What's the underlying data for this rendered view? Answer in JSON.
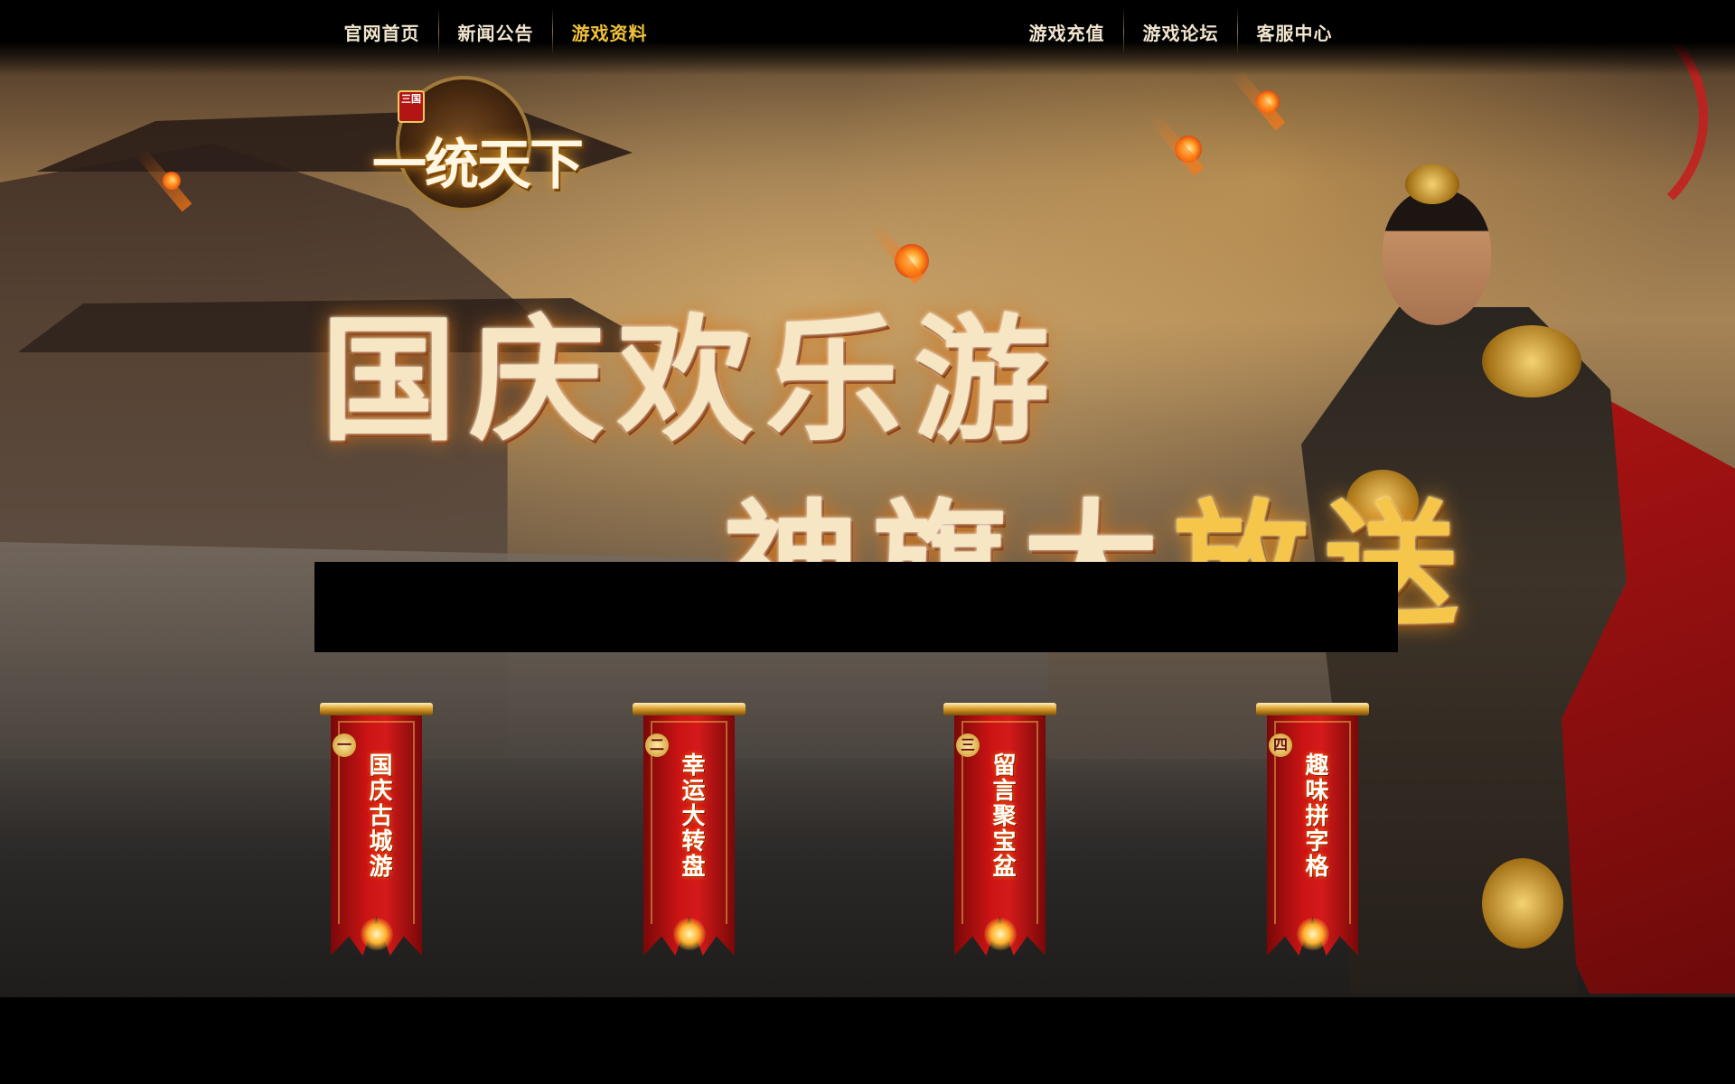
{
  "nav": {
    "left": [
      {
        "label": "官网首页",
        "active": false
      },
      {
        "label": "新闻公告",
        "active": false
      },
      {
        "label": "游戏资料",
        "active": true
      }
    ],
    "right": [
      {
        "label": "游戏充值"
      },
      {
        "label": "游戏论坛"
      },
      {
        "label": "客服中心"
      }
    ],
    "active_color": "#f0c23a"
  },
  "logo": {
    "badge": "三国",
    "title": "一统天下"
  },
  "headline": {
    "line1": "国庆欢乐游",
    "line2_white": "神旗大",
    "line2_gold": "放送"
  },
  "banners": [
    {
      "num": "一",
      "label": "国庆古城游"
    },
    {
      "num": "二",
      "label": "幸运大转盘"
    },
    {
      "num": "三",
      "label": "留言聚宝盆"
    },
    {
      "num": "四",
      "label": "趣味拼字格"
    }
  ],
  "colors": {
    "banner_red": "#cc1414",
    "gold": "#d59a25"
  }
}
